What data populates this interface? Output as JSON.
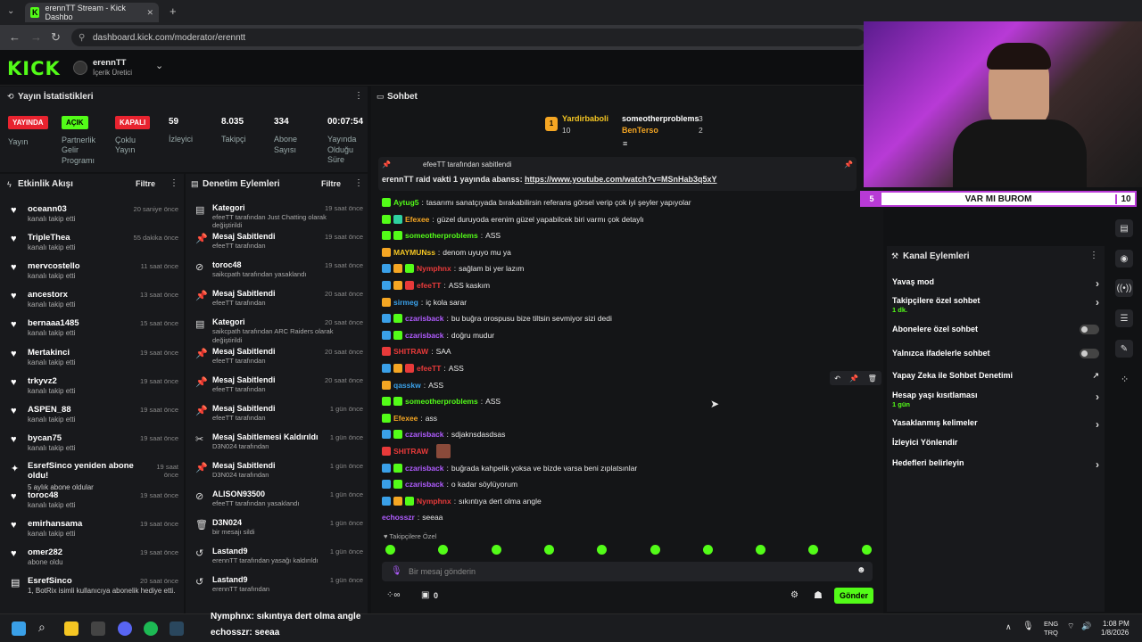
{
  "browser": {
    "tab_title": "erennTT Stream - Kick Dashbo",
    "url": "dashboard.kick.com/moderator/erenntt",
    "new_tab": "+"
  },
  "header": {
    "logo": "KICK",
    "user": "erennTT",
    "role": "İçerik Üretici"
  },
  "stats": {
    "title": "Yayın İstatistikleri",
    "items": [
      {
        "badge": "YAYINDA",
        "label": "Yayın",
        "color": "#e8232f"
      },
      {
        "badge": "AÇIK",
        "label": "Partnerlik Gelir Programı",
        "color": "#53fc18"
      },
      {
        "badge": "KAPALI",
        "label": "Çoklu Yayın",
        "color": "#e8232f"
      }
    ],
    "numbers": [
      {
        "value": "59",
        "label": "İzleyici"
      },
      {
        "value": "8.035",
        "label": "Takipçi"
      },
      {
        "value": "334",
        "label": "Abone Sayısı"
      },
      {
        "value": "00:07:54",
        "label": "Yayında Olduğu Süre"
      }
    ]
  },
  "activity": {
    "title": "Etkinlik Akışı",
    "filter": "Filtre",
    "items": [
      {
        "name": "oceann03",
        "sub": "kanalı takip etti",
        "time": "20 saniye önce"
      },
      {
        "name": "TripleThea",
        "sub": "kanalı takip etti",
        "time": "55 dakika önce"
      },
      {
        "name": "mervcostello",
        "sub": "kanalı takip etti",
        "time": "11 saat önce"
      },
      {
        "name": "ancestorx",
        "sub": "kanalı takip etti",
        "time": "13 saat önce"
      },
      {
        "name": "bernaaa1485",
        "sub": "kanalı takip etti",
        "time": "15 saat önce"
      },
      {
        "name": "Mertakinci",
        "sub": "kanalı takip etti",
        "time": "19 saat önce"
      },
      {
        "name": "trkyvz2",
        "sub": "kanalı takip etti",
        "time": "19 saat önce"
      },
      {
        "name": "ASPEN_88",
        "sub": "kanalı takip etti",
        "time": "19 saat önce"
      },
      {
        "name": "bycan75",
        "sub": "kanalı takip etti",
        "time": "19 saat önce"
      },
      {
        "name": "EsrefSinco yeniden abone oldu!",
        "sub": "5 aylık abone oldular",
        "time": "19 saat önce"
      },
      {
        "name": "toroc48",
        "sub": "kanalı takip etti",
        "time": "19 saat önce"
      },
      {
        "name": "emirhansama",
        "sub": "kanalı takip etti",
        "time": "19 saat önce"
      },
      {
        "name": "omer282",
        "sub": "abone oldu",
        "time": "19 saat önce"
      },
      {
        "name": "EsrefSinco",
        "sub": "1, BotRix isimli kullanıcıya abonelik hediye etti.",
        "time": "20 saat önce"
      }
    ]
  },
  "moderation": {
    "title": "Denetim Eylemleri",
    "filter": "Filtre",
    "items": [
      {
        "title": "Kategori",
        "sub": "efeeTT tarafından Just Chatting olarak değiştirildi",
        "time": "19 saat önce"
      },
      {
        "title": "Mesaj Sabitlendi",
        "sub": "efeeTT tarafından",
        "time": "19 saat önce"
      },
      {
        "title": "toroc48",
        "sub": "saikcpath tarafından yasaklandı",
        "time": "19 saat önce"
      },
      {
        "title": "Mesaj Sabitlendi",
        "sub": "efeeTT tarafından",
        "time": "20 saat önce"
      },
      {
        "title": "Kategori",
        "sub": "saikcpath tarafından ARC Raiders olarak değiştirildi",
        "time": "20 saat önce"
      },
      {
        "title": "Mesaj Sabitlendi",
        "sub": "efeeTT tarafından",
        "time": "20 saat önce"
      },
      {
        "title": "Mesaj Sabitlendi",
        "sub": "efeeTT tarafından",
        "time": "20 saat önce"
      },
      {
        "title": "Mesaj Sabitlendi",
        "sub": "efeeTT tarafından",
        "time": "1 gün önce"
      },
      {
        "title": "Mesaj Sabitlemesi Kaldırıldı",
        "sub": "D3N024 tarafından",
        "time": "1 gün önce"
      },
      {
        "title": "Mesaj Sabitlendi",
        "sub": "D3N024 tarafından",
        "time": "1 gün önce"
      },
      {
        "title": "ALISON93500",
        "sub": "efeeTT tarafından yasaklandı",
        "time": "1 gün önce"
      },
      {
        "title": "D3N024",
        "sub": "bir mesajı sildi",
        "time": "1 gün önce"
      },
      {
        "title": "Lastand9",
        "sub": "erennTT tarafından yasağı kaldırıldı",
        "time": "1 gün önce"
      },
      {
        "title": "Lastand9",
        "sub": "erennTT tarafından",
        "time": "1 gün önce"
      }
    ]
  },
  "chat": {
    "title": "Sohbet",
    "leaderboard": {
      "first": "Yardirbaboli",
      "first_count": "10",
      "second": "someotherproblems",
      "second_count": "3",
      "third": "BenTerso",
      "third_count": "2"
    },
    "pinned_by": "efeeTT tarafından sabitlendi",
    "pinned_text": "erennTT raid vakti 1 yayında abanss: ",
    "pinned_link": "https://www.youtube.com/watch?v=MSnHab3q5xY",
    "messages": [
      {
        "user": "Aytug5",
        "color": "#53fc18",
        "text": "tasarımı sanatçıyada bırakabilirsin referans görsel verip çok iyi şeyler yapıyolar"
      },
      {
        "user": "Efexee",
        "color": "#f5a623",
        "text": "güzel duruyoda erenim güzel yapabilcek biri varmı çok detaylı"
      },
      {
        "user": "someotherproblems",
        "color": "#53fc18",
        "text": "ASS"
      },
      {
        "user": "MAYMUNss",
        "color": "#f5c623",
        "text": "denom uyuyo mu ya"
      },
      {
        "user": "Nymphnx",
        "color": "#e83a3a",
        "text": "sağlam bi yer lazım"
      },
      {
        "user": "efeeTT",
        "color": "#e83a3a",
        "text": "ASS kaskım"
      },
      {
        "user": "sirmeg",
        "color": "#3aa0e8",
        "text": "iç kola sarar"
      },
      {
        "user": "czarisback",
        "color": "#b05cff",
        "text": "bu buğra orospusu bize tiltsin sevmiyor sizi dedi"
      },
      {
        "user": "czarisback",
        "color": "#b05cff",
        "text": "doğru mudur"
      },
      {
        "user": "SHITRAW",
        "color": "#e83a3a",
        "text": "SAA"
      },
      {
        "user": "efeeTT",
        "color": "#e83a3a",
        "text": "ASS"
      },
      {
        "user": "qasskw",
        "color": "#3aa0e8",
        "text": "ASS"
      },
      {
        "user": "someotherproblems",
        "color": "#53fc18",
        "text": "ASS"
      },
      {
        "user": "Efexee",
        "color": "#f5a623",
        "text": "ass"
      },
      {
        "user": "czarisback",
        "color": "#b05cff",
        "text": "sdjaknsdasdsas"
      },
      {
        "user": "SHITRAW",
        "color": "#e83a3a",
        "text": ""
      },
      {
        "user": "czarisback",
        "color": "#b05cff",
        "text": "buğrada kahpelik yoksa ve bizde varsa beni zıplatsınlar"
      },
      {
        "user": "czarisback",
        "color": "#b05cff",
        "text": "o kadar söylüyorum"
      },
      {
        "user": "Nymphnx",
        "color": "#e83a3a",
        "text": "sıkıntıya dert olma angle"
      },
      {
        "user": "echosszr",
        "color": "#b05cff",
        "text": "seeaa"
      }
    ],
    "followers_only": "Takipçilere Özel",
    "input_placeholder": "Bir mesaj gönderin",
    "footer_count": "0",
    "send": "Gönder"
  },
  "overlay": {
    "left": "5",
    "center": "VAR MI BUROM",
    "right": "10",
    "tick1": "Nymphnx: sıkıntıya dert olma angle",
    "tick2": "echosszr: seeaa"
  },
  "channel": {
    "title": "Kanal Eylemleri",
    "items": [
      {
        "label": "Yavaş mod",
        "sub": "",
        "ctrl": "chev"
      },
      {
        "label": "Takipçilere özel sohbet",
        "sub": "1 dk.",
        "ctrl": "chev"
      },
      {
        "label": "Abonelere özel sohbet",
        "sub": "",
        "ctrl": "toggle"
      },
      {
        "label": "Yalnızca ifadelerle sohbet",
        "sub": "",
        "ctrl": "toggle"
      },
      {
        "label": "Yapay Zeka ile Sohbet Denetimi",
        "sub": "",
        "ctrl": "ext"
      },
      {
        "label": "Hesap yaşı kısıtlaması",
        "sub": "1 gün",
        "ctrl": "chev"
      },
      {
        "label": "Yasaklanmış kelimeler",
        "sub": "",
        "ctrl": "chev"
      },
      {
        "label": "İzleyici Yönlendir",
        "sub": "",
        "ctrl": ""
      },
      {
        "label": "Hedefleri belirleyin",
        "sub": "",
        "ctrl": "chev"
      }
    ]
  },
  "taskbar": {
    "lang1": "ENG",
    "lang2": "TRQ",
    "time": "1:08 PM",
    "date": "1/8/2026"
  },
  "colors": {
    "accent": "#53fc18",
    "live": "#e8232f",
    "bg": "#18191c"
  }
}
